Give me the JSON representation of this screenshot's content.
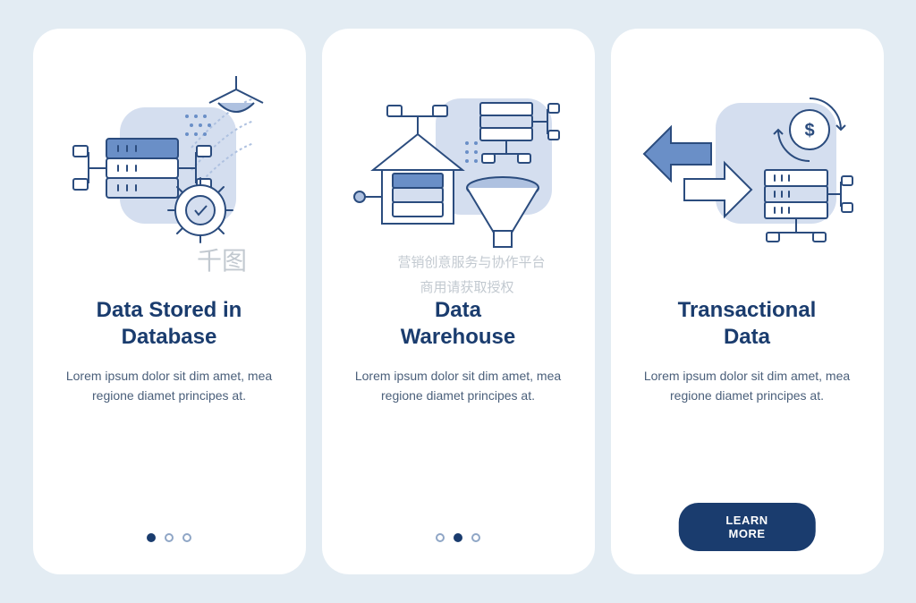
{
  "cards": [
    {
      "title": "Data Stored in\nDatabase",
      "description": "Lorem ipsum dolor sit dim amet, mea regione diamet principes at.",
      "has_pager": true,
      "active_dot": 0,
      "has_cta": false
    },
    {
      "title": "Data\nWarehouse",
      "description": "Lorem ipsum dolor sit dim amet, mea regione diamet principes at.",
      "has_pager": true,
      "active_dot": 1,
      "has_cta": false
    },
    {
      "title": "Transactional\nData",
      "description": "Lorem ipsum dolor sit dim amet, mea regione diamet principes at.",
      "has_pager": false,
      "has_cta": true,
      "cta_label": "LEARN MORE"
    }
  ],
  "watermark": {
    "line1": "营销创意服务与协作平台",
    "line2": "商用请获取授权",
    "logo": "千图"
  }
}
